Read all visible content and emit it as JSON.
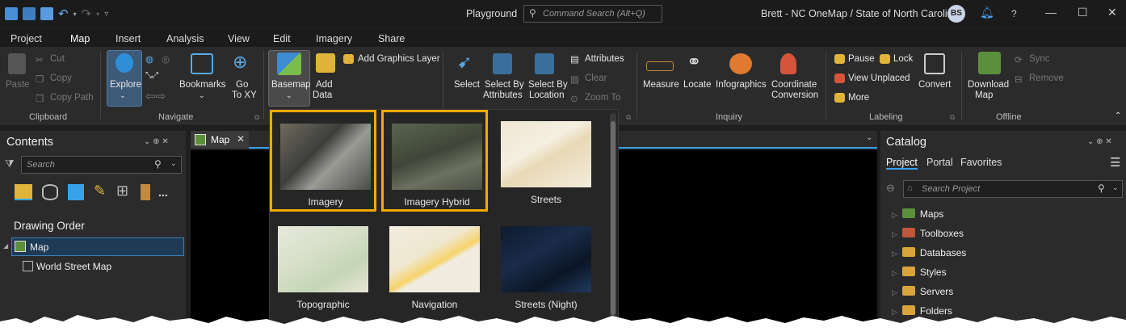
{
  "titlebar": {
    "app": "Playground",
    "command_search_placeholder": "Command Search (Alt+Q)",
    "user": "Brett - NC OneMap / State of North Carolina",
    "avatar_initials": "BS",
    "help": "?"
  },
  "tabs": [
    "Project",
    "Map",
    "Insert",
    "Analysis",
    "View",
    "Edit",
    "Imagery",
    "Share"
  ],
  "ribbon": {
    "clipboard": {
      "paste": "Paste",
      "cut": "Cut",
      "copy": "Copy",
      "copy_path": "Copy Path",
      "group": "Clipboard"
    },
    "navigate": {
      "explore": "Explore",
      "bookmarks": "Bookmarks",
      "go": "Go",
      "to_xy": "To XY",
      "group": "Navigate"
    },
    "layer": {
      "basemap": "Basemap",
      "add": "Add",
      "data": "Data",
      "add_graphics": "Add Graphics Layer"
    },
    "selection": {
      "select": "Select",
      "select_by": "Select By",
      "attributes": "Attributes",
      "location": "Location",
      "attributes_btn": "Attributes",
      "clear": "Clear",
      "zoom_to": "Zoom To"
    },
    "inquiry": {
      "measure": "Measure",
      "locate": "Locate",
      "infographics": "Infographics",
      "coordinate": "Coordinate",
      "conversion": "Conversion",
      "group": "Inquiry"
    },
    "labeling": {
      "pause": "Pause",
      "lock": "Lock",
      "view_unplaced": "View Unplaced",
      "more": "More",
      "convert": "Convert",
      "group": "Labeling"
    },
    "offline": {
      "download": "Download",
      "map": "Map",
      "sync": "Sync",
      "remove": "Remove",
      "group": "Offline"
    }
  },
  "contents": {
    "title": "Contents",
    "search_placeholder": "Search",
    "drawing_order": "Drawing Order",
    "map_layer": "Map",
    "basemap_layer": "World Street Map",
    "more": "..."
  },
  "map_tab": "Map",
  "gallery": [
    {
      "label": "Imagery",
      "selected": true
    },
    {
      "label": "Imagery Hybrid",
      "selected": true
    },
    {
      "label": "Streets",
      "selected": false
    },
    {
      "label": "Topographic",
      "selected": false
    },
    {
      "label": "Navigation",
      "selected": false
    },
    {
      "label": "Streets (Night)",
      "selected": false
    }
  ],
  "catalog": {
    "title": "Catalog",
    "tabs": [
      "Project",
      "Portal",
      "Favorites"
    ],
    "search_placeholder": "Search Project",
    "items": [
      "Maps",
      "Toolboxes",
      "Databases",
      "Styles",
      "Servers",
      "Folders"
    ]
  },
  "colors": {
    "accent": "#37a2ea",
    "highlight": "#f2a900"
  }
}
